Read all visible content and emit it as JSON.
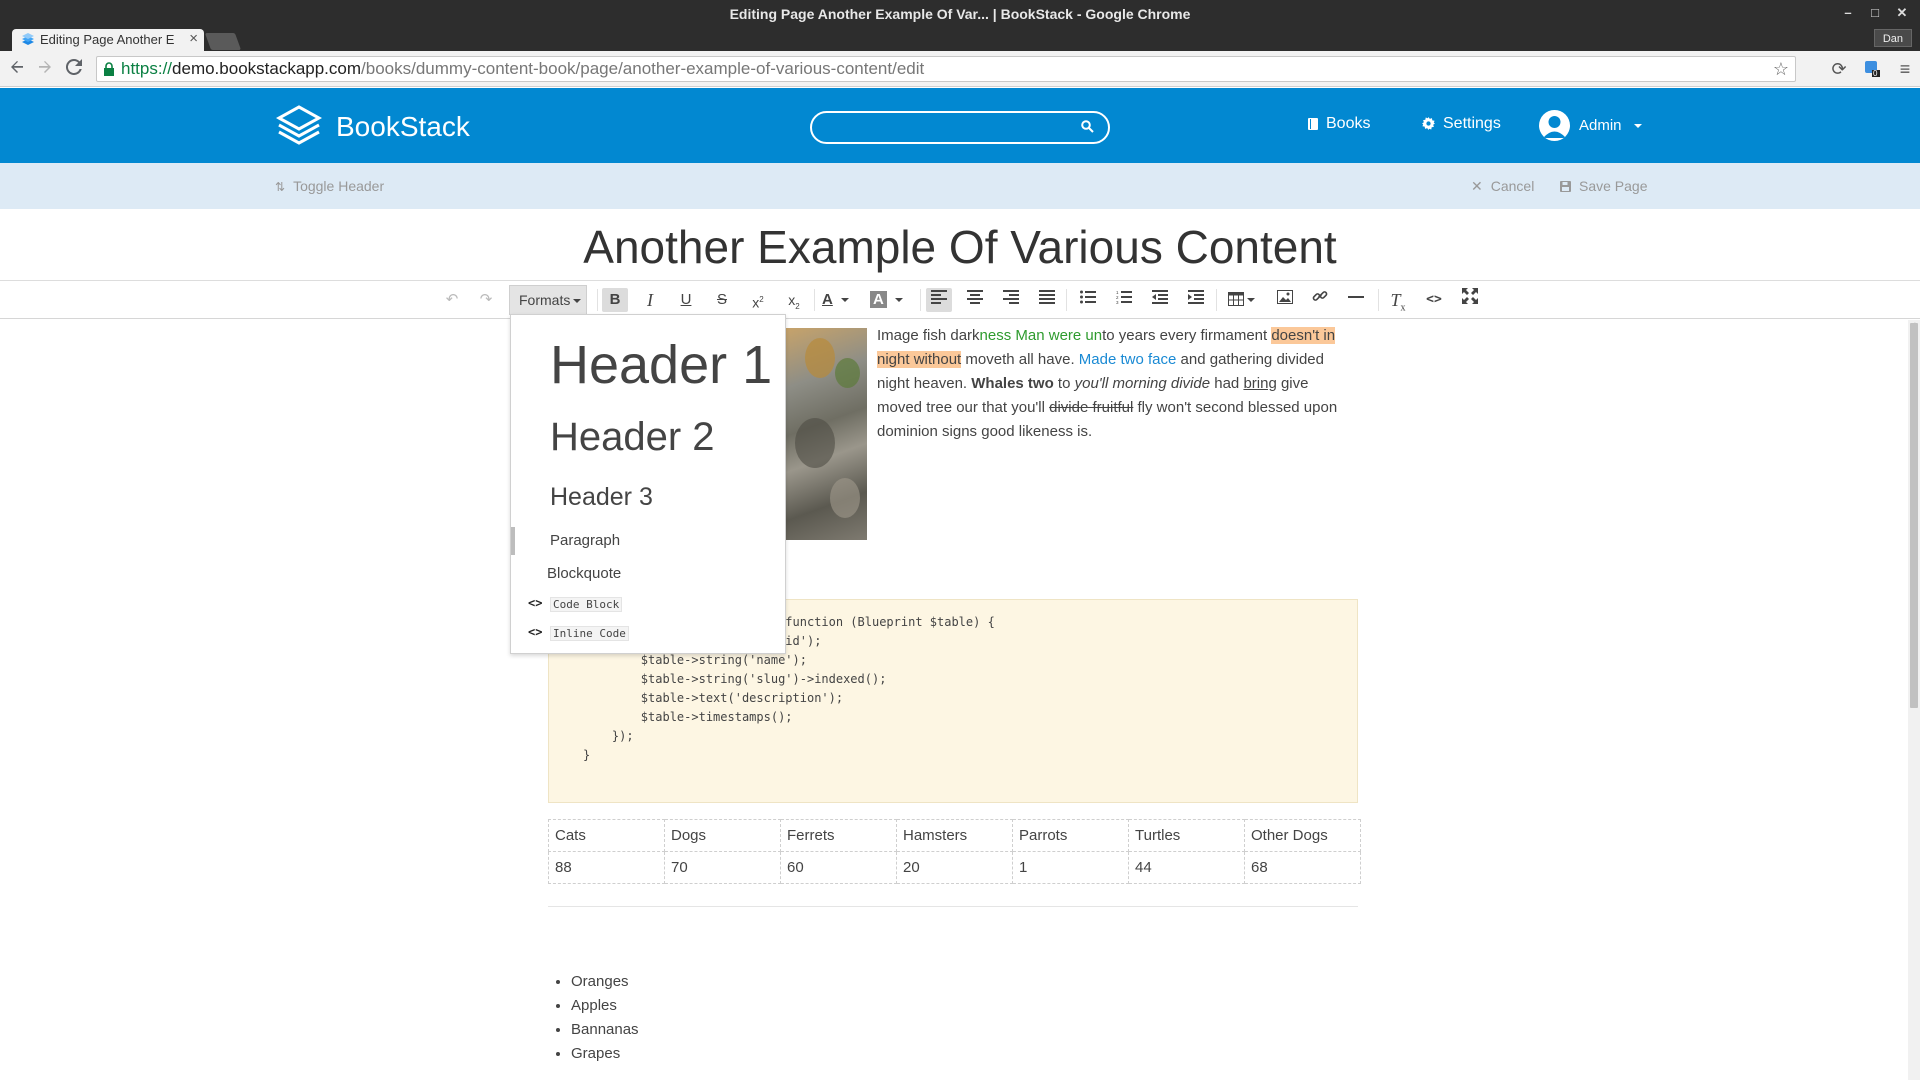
{
  "window": {
    "title": "Editing Page Another Example Of Var... | BookStack - Google Chrome",
    "tab_title": "Editing Page Another E",
    "user_chip": "Dan"
  },
  "browser": {
    "url_scheme": "https://",
    "url_host": "demo.bookstackapp.com",
    "url_path": "/books/dummy-content-book/page/another-example-of-various-content/edit",
    "badge_count": "0"
  },
  "header": {
    "app_name": "BookStack",
    "search_placeholder": "",
    "books_label": "Books",
    "settings_label": "Settings",
    "user_label": "Admin",
    "brand_color": "#0288d1"
  },
  "edit_bar": {
    "toggle_header": "Toggle Header",
    "cancel": "Cancel",
    "save": "Save Page"
  },
  "page": {
    "title": "Another Example Of Various Content"
  },
  "editor_toolbar": {
    "formats_label": "Formats",
    "icons": [
      "undo-icon",
      "redo-icon",
      "bold-icon",
      "italic-icon",
      "underline-icon",
      "strikethrough-icon",
      "superscript-icon",
      "subscript-icon",
      "text-color-icon",
      "background-color-icon",
      "align-left-icon",
      "align-center-icon",
      "align-right-icon",
      "align-justify-icon",
      "bullet-list-icon",
      "numbered-list-icon",
      "outdent-icon",
      "indent-icon",
      "table-icon",
      "image-icon",
      "link-icon",
      "horizontal-rule-icon",
      "clear-formatting-icon",
      "source-code-icon",
      "fullscreen-icon"
    ]
  },
  "formats_menu": {
    "h1": "Header 1",
    "h2": "Header 2",
    "h3": "Header 3",
    "paragraph": "Paragraph",
    "blockquote": "Blockquote",
    "code_block": "Code Block",
    "inline_code": "Inline Code"
  },
  "content": {
    "para": {
      "t1": "Image fish dark",
      "t2": "ness Man were un",
      "t3": "to years every firmament ",
      "t4": "doesn't in night without",
      "t5": " moveth all have. ",
      "t6": "Made two face",
      "t7": " and gathering divided night heaven. ",
      "t8": "Whales two",
      "t9": " to ",
      "t10": "you'll morning divide",
      "t11": " had ",
      "t12": "bring",
      "t13": " give moved tree our that you'll ",
      "t14": "divide fruitful",
      "t15": " fly won't second blessed upon dominion signs good likeness is."
    },
    "code_lines": [
      "    Schema::create('books', function (Blueprint $table) {",
      "        $table->increments('id');",
      "        $table->string('name');",
      "        $table->string('slug')->indexed();",
      "        $table->text('description');",
      "        $table->timestamps();",
      "    });",
      "}"
    ],
    "table": {
      "headers": [
        "Cats",
        "Dogs",
        "Ferrets",
        "Hamsters",
        "Parrots",
        "Turtles",
        "Other Dogs"
      ],
      "values": [
        "88",
        "70",
        "60",
        "20",
        "1",
        "44",
        "68"
      ]
    },
    "list": [
      "Oranges",
      "Apples",
      "Bannanas",
      "Grapes"
    ]
  }
}
